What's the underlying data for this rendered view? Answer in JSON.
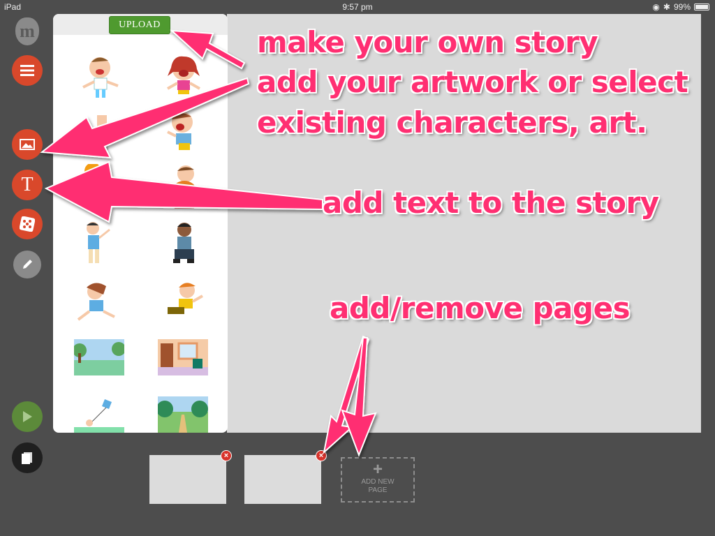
{
  "statusbar": {
    "device": "iPad",
    "time": "9:57 pm",
    "battery": "99%"
  },
  "app": {
    "logo_letter": "m"
  },
  "toolbar": {
    "tools": [
      {
        "name": "menu",
        "icon": "hamburger-icon"
      },
      {
        "name": "images",
        "icon": "image-icon"
      },
      {
        "name": "text",
        "icon": "text-icon",
        "glyph": "T"
      },
      {
        "name": "random",
        "icon": "dice-icon"
      },
      {
        "name": "draw",
        "icon": "pencil-icon"
      },
      {
        "name": "play",
        "icon": "play-icon"
      },
      {
        "name": "book",
        "icon": "book-icon"
      }
    ]
  },
  "art_panel": {
    "upload_label": "UPLOAD",
    "items": [
      "character-boy-laughing",
      "character-girl-laughing",
      "character-boy-shouting",
      "character-boy-yelling",
      "character-boy-orange",
      "character-boy-heavy",
      "character-boy-waving",
      "character-boy-crouching",
      "character-girl-flying",
      "character-boy-jumping",
      "background-park",
      "background-room",
      "background-kite",
      "background-garden"
    ]
  },
  "pages": {
    "add_label": "ADD NEW PAGE",
    "plus": "+",
    "remove_glyph": "×"
  },
  "annotations": {
    "line1": "make your own story",
    "line2": "add your artwork or select",
    "line3": "existing characters, art.",
    "text_note": "add text to the story",
    "pages_note": "add/remove pages"
  },
  "colors": {
    "accent": "#ff2f72",
    "tool_red": "#d9482b",
    "upload_green": "#4f9a2f",
    "background": "#4d4d4d",
    "canvas": "#dadada"
  }
}
